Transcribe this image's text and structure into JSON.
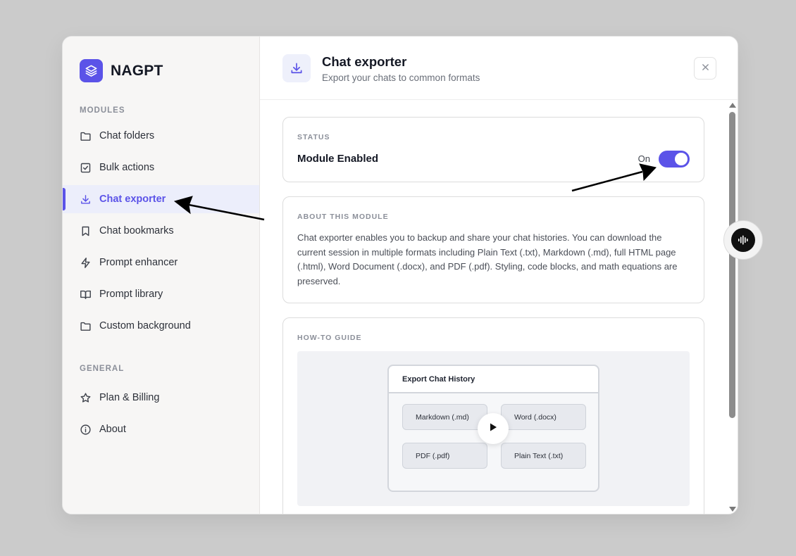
{
  "brand": {
    "name": "NAGPT"
  },
  "sidebar": {
    "modules_label": "MODULES",
    "general_label": "GENERAL",
    "modules": [
      {
        "label": "Chat folders",
        "icon": "folder-icon"
      },
      {
        "label": "Bulk actions",
        "icon": "checkbox-icon"
      },
      {
        "label": "Chat exporter",
        "icon": "download-icon",
        "active": true
      },
      {
        "label": "Chat bookmarks",
        "icon": "bookmark-icon"
      },
      {
        "label": "Prompt enhancer",
        "icon": "lightning-icon"
      },
      {
        "label": "Prompt library",
        "icon": "book-icon"
      },
      {
        "label": "Custom background",
        "icon": "folder-icon"
      }
    ],
    "general": [
      {
        "label": "Plan & Billing",
        "icon": "star-icon"
      },
      {
        "label": "About",
        "icon": "info-icon"
      }
    ]
  },
  "header": {
    "title": "Chat exporter",
    "subtitle": "Export your chats to common formats"
  },
  "status": {
    "label": "STATUS",
    "title": "Module Enabled",
    "toggle_label": "On",
    "enabled": true
  },
  "about": {
    "label": "ABOUT THIS MODULE",
    "text": "Chat exporter enables you to backup and share your chat histories. You can download the current session in multiple formats including Plain Text (.txt), Markdown (.md), full HTML page (.html), Word Document (.docx), and PDF (.pdf). Styling, code blocks, and math equations are preserved."
  },
  "guide": {
    "label": "HOW-TO GUIDE",
    "window_title": "Export Chat History",
    "formats": [
      "Markdown (.md)",
      "Word (.docx)",
      "PDF (.pdf)",
      "Plain Text (.txt)"
    ]
  },
  "colors": {
    "accent": "#5b53e8",
    "backdrop": "#cbcbcb",
    "sidebar_bg": "#f7f6f5",
    "active_bg": "#eceefb"
  }
}
